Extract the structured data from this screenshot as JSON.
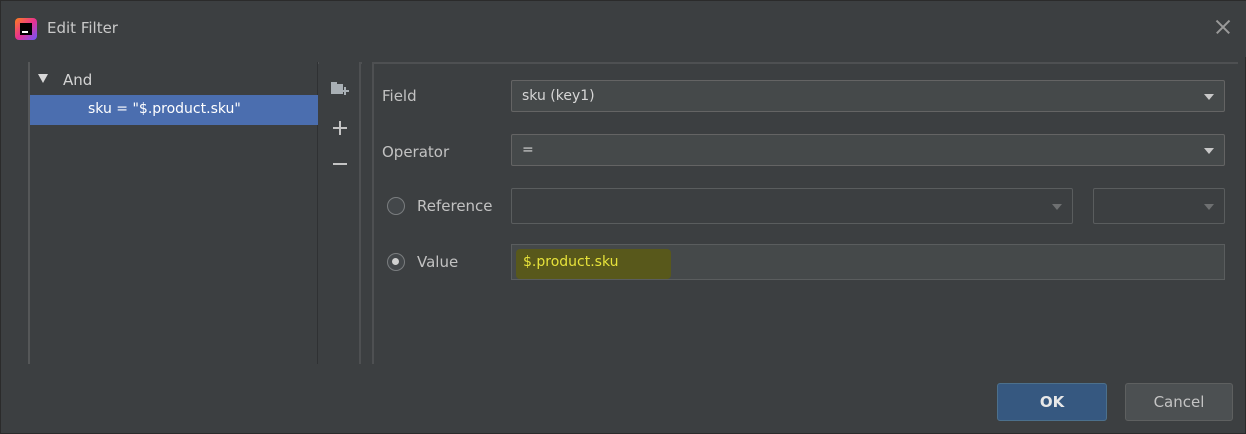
{
  "window": {
    "title": "Edit Filter"
  },
  "tree": {
    "root_label": "And",
    "items": [
      {
        "label": "sku = \"$.product.sku\"",
        "selected": true
      }
    ]
  },
  "form": {
    "field": {
      "label": "Field",
      "value": "sku (key1)"
    },
    "operator": {
      "label": "Operator",
      "value": "="
    },
    "reference": {
      "label": "Reference",
      "value": "",
      "secondary_value": "",
      "checked": false
    },
    "value": {
      "label": "Value",
      "text": "$.product.sku",
      "checked": true
    }
  },
  "buttons": {
    "ok_label": "OK",
    "cancel_label": "Cancel"
  },
  "colors": {
    "accent": "#4b6eaf",
    "ok_button": "#365880",
    "value_highlight": "#e6e23a"
  }
}
